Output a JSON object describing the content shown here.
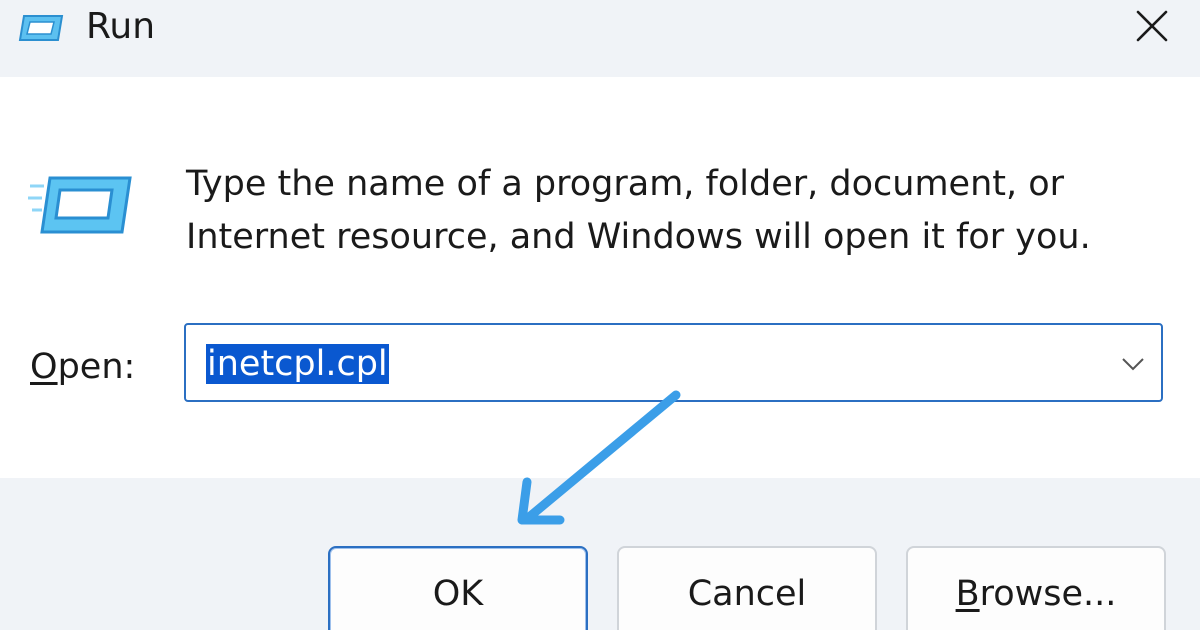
{
  "titlebar": {
    "title": "Run",
    "icon": "run-icon",
    "close_icon": "close-icon"
  },
  "body": {
    "icon": "run-icon",
    "description": "Type the name of a program, folder, document, or Internet resource, and Windows will open it for you.",
    "open_label_mnemonic": "O",
    "open_label_rest": "pen:",
    "open_value": "inetcpl.cpl",
    "dropdown_icon": "chevron-down-icon"
  },
  "buttons": {
    "ok": "OK",
    "cancel": "Cancel",
    "browse_mnemonic": "B",
    "browse_rest": "rowse..."
  },
  "annotation": {
    "arrow_icon": "arrow-icon",
    "arrow_color": "#3b9ee8"
  },
  "colors": {
    "accent": "#2b6fc2",
    "selection": "#0a58d0",
    "chrome": "#f0f3f7"
  }
}
